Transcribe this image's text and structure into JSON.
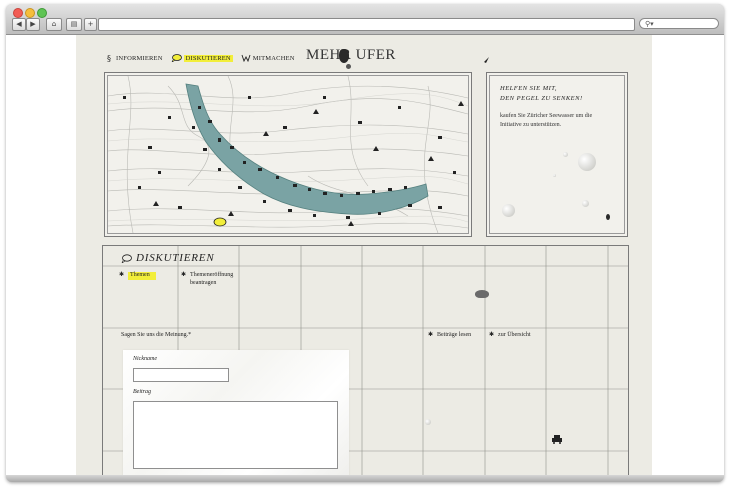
{
  "nav": {
    "items": [
      {
        "label": "Informieren"
      },
      {
        "label": "Diskutieren"
      },
      {
        "label": "Mitmachen"
      }
    ]
  },
  "logo": {
    "text": "MEHR UFER"
  },
  "sidebar": {
    "title": "Helfen Sie mit,\nden Pegel zu senken!",
    "text": "kaufen Sie Züricher Seewasser um die Initiative zu unterstützen."
  },
  "forum": {
    "title": "Diskutieren",
    "options": {
      "themen": "Themen",
      "themeneroeffnung": "Themeneröffnung beantragen",
      "beitraege": "Beiträge lesen",
      "uebersicht": "zur Übersicht"
    },
    "prompt": "Sagen Sie uns die Meinung.*",
    "nickname_label": "Nickname",
    "beitrag_label": "Beitrag"
  },
  "colors": {
    "highlight": "#f2ee3a",
    "lake": "#7aa3a4",
    "paper": "#ecebe4"
  }
}
